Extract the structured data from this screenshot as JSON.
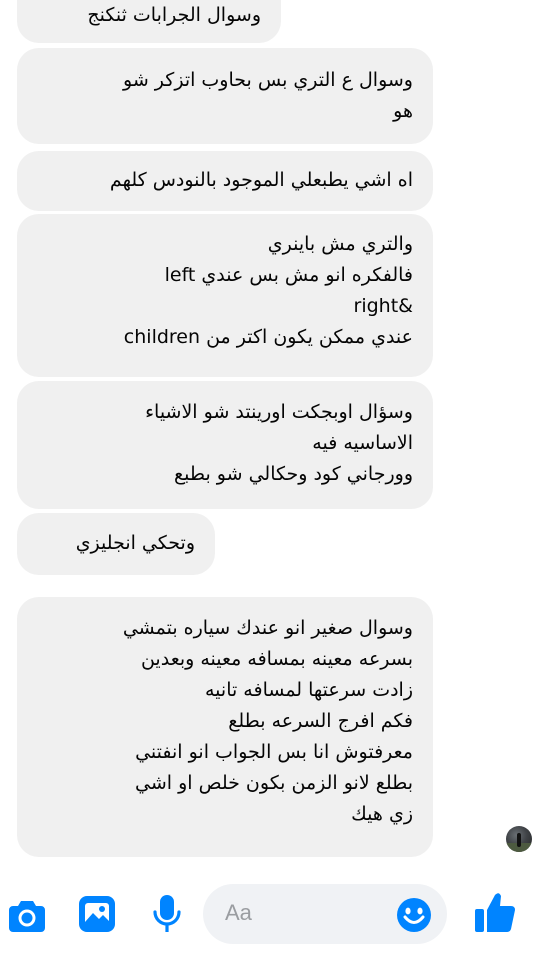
{
  "messages": [
    {
      "text": "وسوال الجرابات ثنكنج"
    },
    {
      "text": "وسوال ع التري بس بحاوب اتزكر شو\nهو"
    },
    {
      "text": "اه اشي يطبعلي الموجود بالنودس كلهم"
    },
    {
      "text": "والتري مش باينري\nفالفكره انو مش بس عندي left\n&right\nعندي ممكن يكون اكتر من children"
    },
    {
      "text": "وسؤال اوبجكت اورينتد شو الاشياء\nالاساسيه فيه\nوورجاني كود وحكالي شو بطبع"
    },
    {
      "text": "وتحكي انجليزي"
    },
    {
      "text": "وسوال صغير انو عندك سياره بتمشي\nبسرعه معينه بمسافه معينه وبعدين\nزادت سرعتها لمسافه تانيه\nفكم افرج السرعه بطلع\nمعرفتوش انا بس الجواب انو انفتني\nبطلع لانو الزمن بكون خلص او اشي\nزي هيك"
    }
  ],
  "composer": {
    "placeholder": "Aa",
    "accent_color": "#0084ff"
  },
  "icons": [
    "camera-icon",
    "image-icon",
    "microphone-icon",
    "emoji-icon",
    "thumbs-up-icon"
  ]
}
